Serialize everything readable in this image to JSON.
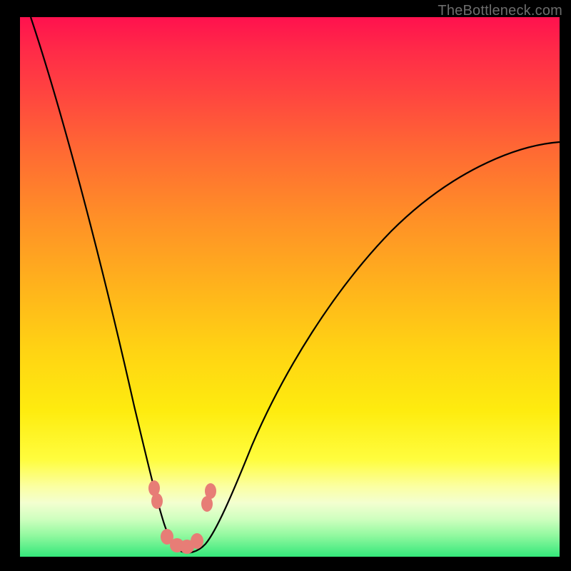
{
  "watermark": "TheBottleneck.com",
  "colors": {
    "frame_bg": "#000000",
    "gradient_top": "#ff114e",
    "gradient_mid": "#feec0f",
    "gradient_bottom": "#34e77a",
    "curve": "#000000",
    "marker": "#e77d76"
  },
  "chart_data": {
    "type": "line",
    "title": "",
    "xlabel": "",
    "ylabel": "",
    "xlim": [
      0,
      100
    ],
    "ylim": [
      0,
      100
    ],
    "grid": false,
    "legend": false,
    "comment": "x is a normalized 0–100 horizontal axis; y is 0 (bottom, green, best match) to 100 (top, red, worst). Curve estimated from pixel positions: steep descent to a minimum near x≈28, then a gentler rise toward the upper right.",
    "series": [
      {
        "name": "bottleneck-curve",
        "x": [
          2,
          5,
          8,
          11,
          14,
          17,
          20,
          22,
          24,
          26,
          27,
          28,
          29,
          30,
          31,
          32,
          34,
          37,
          41,
          46,
          52,
          60,
          68,
          76,
          84,
          92,
          100
        ],
        "y": [
          100,
          89,
          78,
          67,
          56,
          45,
          34,
          25,
          17,
          10,
          6,
          3,
          2,
          2,
          3,
          5,
          9,
          15,
          23,
          32,
          41,
          51,
          59,
          66,
          71,
          75,
          77
        ]
      }
    ],
    "markers": [
      {
        "name": "left-shoulder",
        "x": 24.5,
        "y": 13
      },
      {
        "name": "left-shoulder-2",
        "x": 25.0,
        "y": 11
      },
      {
        "name": "trough-1",
        "x": 27.0,
        "y": 4
      },
      {
        "name": "trough-2",
        "x": 28.5,
        "y": 3
      },
      {
        "name": "trough-3",
        "x": 30.0,
        "y": 3
      },
      {
        "name": "trough-4",
        "x": 31.2,
        "y": 4
      },
      {
        "name": "right-shoulder",
        "x": 33.8,
        "y": 11
      },
      {
        "name": "right-shoulder-2",
        "x": 34.4,
        "y": 13
      }
    ]
  }
}
